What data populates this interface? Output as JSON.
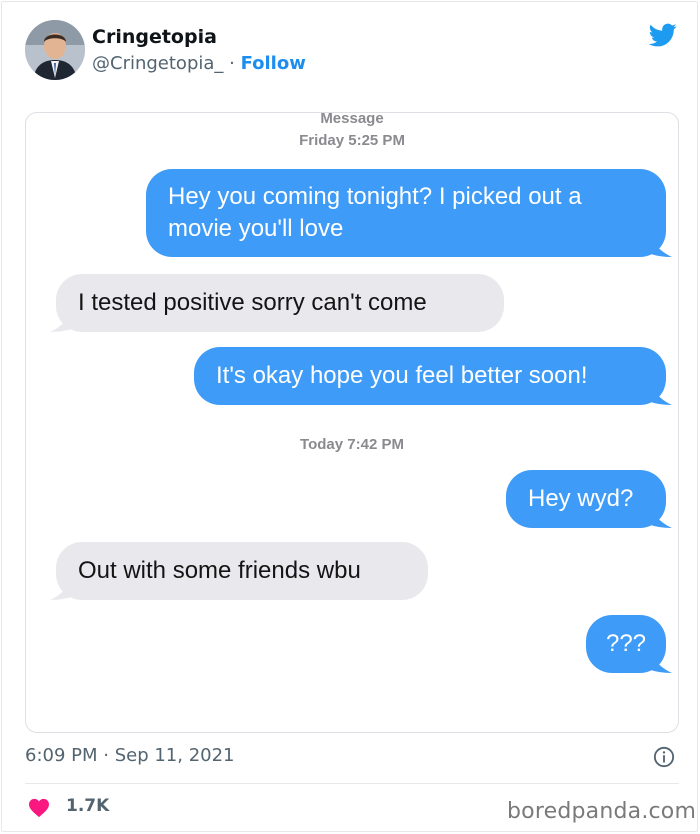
{
  "tweet": {
    "display_name": "Cringetopia",
    "handle": "@Cringetopia_",
    "separator": " · ",
    "follow_label": "Follow",
    "timestamp": "6:09 PM · Sep 11, 2021",
    "like_count": "1.7K"
  },
  "icons": {
    "brand": "twitter-bird-icon",
    "info": "info-icon",
    "like": "heart-icon"
  },
  "colors": {
    "accent": "#1d8ef0",
    "sent_bubble": "#3e9bf7",
    "received_bubble": "#e9e9ed",
    "like": "#f91880"
  },
  "messages": {
    "thread_label": "Message",
    "first_time": "Friday 5:25 PM",
    "second_time": "Today 7:42 PM",
    "m1": "Hey you coming tonight? I picked out a movie you'll love",
    "m2": "I tested positive sorry can't come",
    "m3": "It's okay hope you feel better soon!",
    "m4": "Hey wyd?",
    "m5": "Out with some friends wbu",
    "m6": "???"
  },
  "watermark": "boredpanda.com"
}
